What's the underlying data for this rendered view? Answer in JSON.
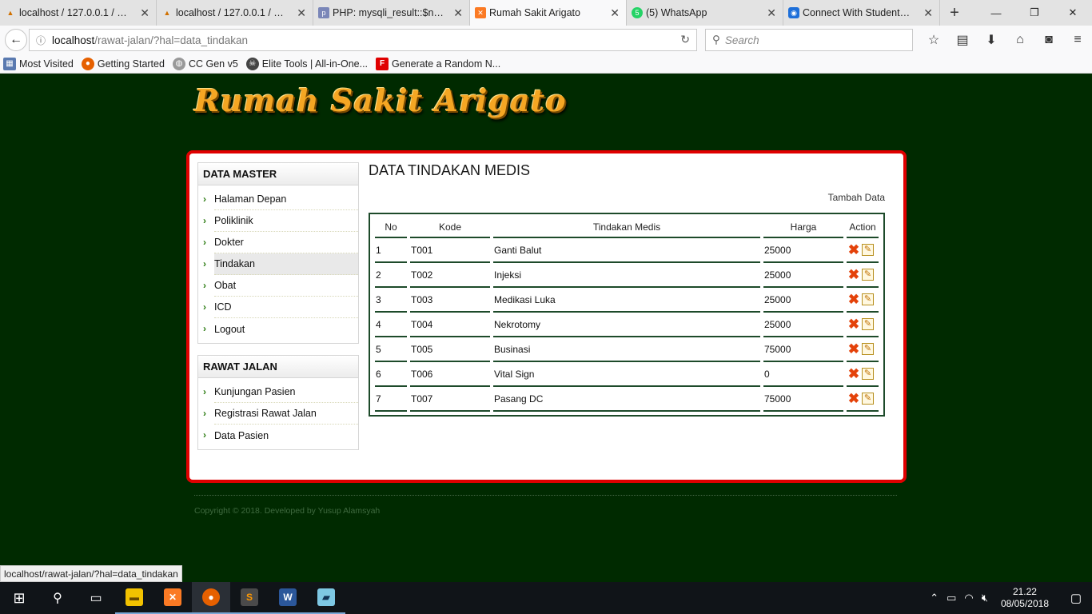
{
  "browser": {
    "tabs": [
      {
        "label": "localhost / 127.0.0.1 / …",
        "icon": "PMA"
      },
      {
        "label": "localhost / 127.0.0.1 / …",
        "icon": "PMA"
      },
      {
        "label": "PHP: mysqli_result::$n…",
        "icon": "php"
      },
      {
        "label": "Rumah Sakit Arigato",
        "icon": "xampp"
      },
      {
        "label": "(5) WhatsApp",
        "icon": "5"
      },
      {
        "label": "Connect With Student…",
        "icon": "vpn"
      }
    ],
    "url_host": "localhost",
    "url_path": "/rawat-jalan/?hal=data_tindakan",
    "search_placeholder": "Search",
    "bookmarks": [
      {
        "label": "Most Visited"
      },
      {
        "label": "Getting Started"
      },
      {
        "label": "CC Gen v5"
      },
      {
        "label": "Elite Tools | All-in-One..."
      },
      {
        "label": "Generate a Random N..."
      }
    ],
    "status_url": "localhost/rawat-jalan/?hal=data_tindakan"
  },
  "site": {
    "logo_text": "Rumah Sakit Arigato",
    "sidebar": {
      "data_master": {
        "title": "DATA MASTER",
        "items": [
          "Halaman Depan",
          "Poliklinik",
          "Dokter",
          "Tindakan",
          "Obat",
          "ICD",
          "Logout"
        ],
        "active": "Tindakan"
      },
      "rawat_jalan": {
        "title": "RAWAT JALAN",
        "items": [
          "Kunjungan Pasien",
          "Registrasi Rawat Jalan",
          "Data Pasien"
        ]
      }
    },
    "main": {
      "title": "DATA TINDAKAN MEDIS",
      "add_link": "Tambah Data",
      "columns": [
        "No",
        "Kode",
        "Tindakan Medis",
        "Harga",
        "Action"
      ],
      "rows": [
        {
          "no": "1",
          "kode": "T001",
          "tindakan": "Ganti Balut",
          "harga": "25000"
        },
        {
          "no": "2",
          "kode": "T002",
          "tindakan": "Injeksi",
          "harga": "25000"
        },
        {
          "no": "3",
          "kode": "T003",
          "tindakan": "Medikasi Luka",
          "harga": "25000"
        },
        {
          "no": "4",
          "kode": "T004",
          "tindakan": "Nekrotomy",
          "harga": "25000"
        },
        {
          "no": "5",
          "kode": "T005",
          "tindakan": "Businasi",
          "harga": "75000"
        },
        {
          "no": "6",
          "kode": "T006",
          "tindakan": "Vital Sign",
          "harga": "0"
        },
        {
          "no": "7",
          "kode": "T007",
          "tindakan": "Pasang DC",
          "harga": "75000"
        }
      ]
    },
    "copyright": "Copyright © 2018. Developed by Yusup Alamsyah"
  },
  "taskbar": {
    "time": "21.22",
    "date": "08/05/2018"
  },
  "colors": {
    "page_bg": "#002a00",
    "content_border": "#e00000",
    "table_border": "#1d4a2a",
    "logo": "#f5a623"
  }
}
